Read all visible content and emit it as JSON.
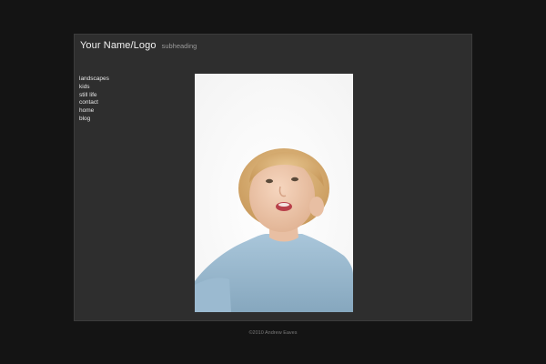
{
  "header": {
    "logo": "Your Name/Logo",
    "subheading": "subheading"
  },
  "nav": {
    "items": [
      "landscapes",
      "kids",
      "still life",
      "contact",
      "home",
      "blog"
    ]
  },
  "footer": {
    "copyright": "©2010 Andrew Eaves"
  },
  "colors": {
    "background": "#141414",
    "panel": "#2e2e2e",
    "text": "#f2f2f2",
    "muted": "#9a9a9a"
  }
}
